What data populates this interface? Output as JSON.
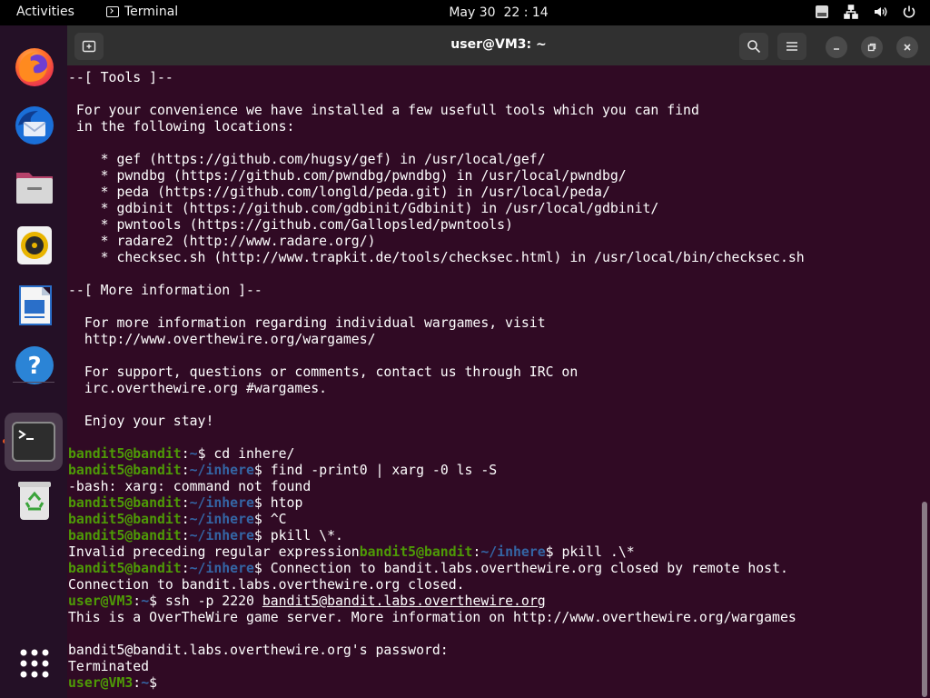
{
  "topbar": {
    "activities": "Activities",
    "app_name": "Terminal",
    "date": "May 30",
    "time": "22 : 14"
  },
  "dock": {
    "items": [
      {
        "name": "firefox",
        "icon": "firefox-icon"
      },
      {
        "name": "thunderbird",
        "icon": "thunderbird-icon"
      },
      {
        "name": "files",
        "icon": "files-icon"
      },
      {
        "name": "rhythmbox",
        "icon": "rhythmbox-icon"
      },
      {
        "name": "libreoffice-writer",
        "icon": "writer-icon"
      },
      {
        "name": "help",
        "icon": "help-icon"
      },
      {
        "name": "terminal",
        "icon": "terminal-icon",
        "active": true
      },
      {
        "name": "trash",
        "icon": "trash-icon"
      },
      {
        "name": "show-apps",
        "icon": "app-grid-icon"
      }
    ]
  },
  "window": {
    "title": "user@VM3: ~"
  },
  "terminal": {
    "lines": [
      [
        {
          "t": "--[ Tools ]--"
        }
      ],
      [
        {
          "t": ""
        }
      ],
      [
        {
          "t": " For your convenience we have installed a few usefull tools which you can find"
        }
      ],
      [
        {
          "t": " in the following locations:"
        }
      ],
      [
        {
          "t": ""
        }
      ],
      [
        {
          "t": "    * gef (https://github.com/hugsy/gef) in /usr/local/gef/"
        }
      ],
      [
        {
          "t": "    * pwndbg (https://github.com/pwndbg/pwndbg) in /usr/local/pwndbg/"
        }
      ],
      [
        {
          "t": "    * peda (https://github.com/longld/peda.git) in /usr/local/peda/"
        }
      ],
      [
        {
          "t": "    * gdbinit (https://github.com/gdbinit/Gdbinit) in /usr/local/gdbinit/"
        }
      ],
      [
        {
          "t": "    * pwntools (https://github.com/Gallopsled/pwntools)"
        }
      ],
      [
        {
          "t": "    * radare2 (http://www.radare.org/)"
        }
      ],
      [
        {
          "t": "    * checksec.sh (http://www.trapkit.de/tools/checksec.html) in /usr/local/bin/checksec.sh"
        }
      ],
      [
        {
          "t": ""
        }
      ],
      [
        {
          "t": "--[ More information ]--"
        }
      ],
      [
        {
          "t": ""
        }
      ],
      [
        {
          "t": "  For more information regarding individual wargames, visit"
        }
      ],
      [
        {
          "t": "  http://www.overthewire.org/wargames/"
        }
      ],
      [
        {
          "t": ""
        }
      ],
      [
        {
          "t": "  For support, questions or comments, contact us through IRC on"
        }
      ],
      [
        {
          "t": "  irc.overthewire.org #wargames."
        }
      ],
      [
        {
          "t": ""
        }
      ],
      [
        {
          "t": "  Enjoy your stay!"
        }
      ],
      [
        {
          "t": ""
        }
      ],
      [
        {
          "t": "bandit5@bandit",
          "c": "u"
        },
        {
          "t": ":"
        },
        {
          "t": "~",
          "c": "p"
        },
        {
          "t": "$ cd inhere/"
        }
      ],
      [
        {
          "t": "bandit5@bandit",
          "c": "u"
        },
        {
          "t": ":"
        },
        {
          "t": "~/inhere",
          "c": "p"
        },
        {
          "t": "$ find -print0 | xarg -0 ls -S"
        }
      ],
      [
        {
          "t": "-bash: xarg: command not found"
        }
      ],
      [
        {
          "t": "bandit5@bandit",
          "c": "u"
        },
        {
          "t": ":"
        },
        {
          "t": "~/inhere",
          "c": "p"
        },
        {
          "t": "$ htop"
        }
      ],
      [
        {
          "t": "bandit5@bandit",
          "c": "u"
        },
        {
          "t": ":"
        },
        {
          "t": "~/inhere",
          "c": "p"
        },
        {
          "t": "$ ^C"
        }
      ],
      [
        {
          "t": "bandit5@bandit",
          "c": "u"
        },
        {
          "t": ":"
        },
        {
          "t": "~/inhere",
          "c": "p"
        },
        {
          "t": "$ pkill \\*."
        }
      ],
      [
        {
          "t": "Invalid preceding regular expression"
        },
        {
          "t": "bandit5@bandit",
          "c": "u"
        },
        {
          "t": ":"
        },
        {
          "t": "~/inhere",
          "c": "p"
        },
        {
          "t": "$ pkill .\\*"
        }
      ],
      [
        {
          "t": "bandit5@bandit",
          "c": "u"
        },
        {
          "t": ":"
        },
        {
          "t": "~/inhere",
          "c": "p"
        },
        {
          "t": "$ Connection to bandit.labs.overthewire.org closed by remote host."
        }
      ],
      [
        {
          "t": "Connection to bandit.labs.overthewire.org closed."
        }
      ],
      [
        {
          "t": "user@VM3",
          "c": "u"
        },
        {
          "t": ":"
        },
        {
          "t": "~",
          "c": "p"
        },
        {
          "t": "$ ssh -p 2220 "
        },
        {
          "t": "bandit5@bandit.labs.overthewire.org",
          "c": "ul"
        }
      ],
      [
        {
          "t": "This is a OverTheWire game server. More information on http://www.overthewire.org/wargames"
        }
      ],
      [
        {
          "t": ""
        }
      ],
      [
        {
          "t": "bandit5@bandit.labs.overthewire.org's password:"
        }
      ],
      [
        {
          "t": "Terminated"
        }
      ],
      [
        {
          "t": "user@VM3",
          "c": "u"
        },
        {
          "t": ":"
        },
        {
          "t": "~",
          "c": "p"
        },
        {
          "t": "$ "
        }
      ]
    ]
  },
  "colors": {
    "terminal_bg": "#300a24",
    "prompt_user": "#4e9a06",
    "prompt_path": "#3465a4",
    "accent": "#e95420"
  }
}
